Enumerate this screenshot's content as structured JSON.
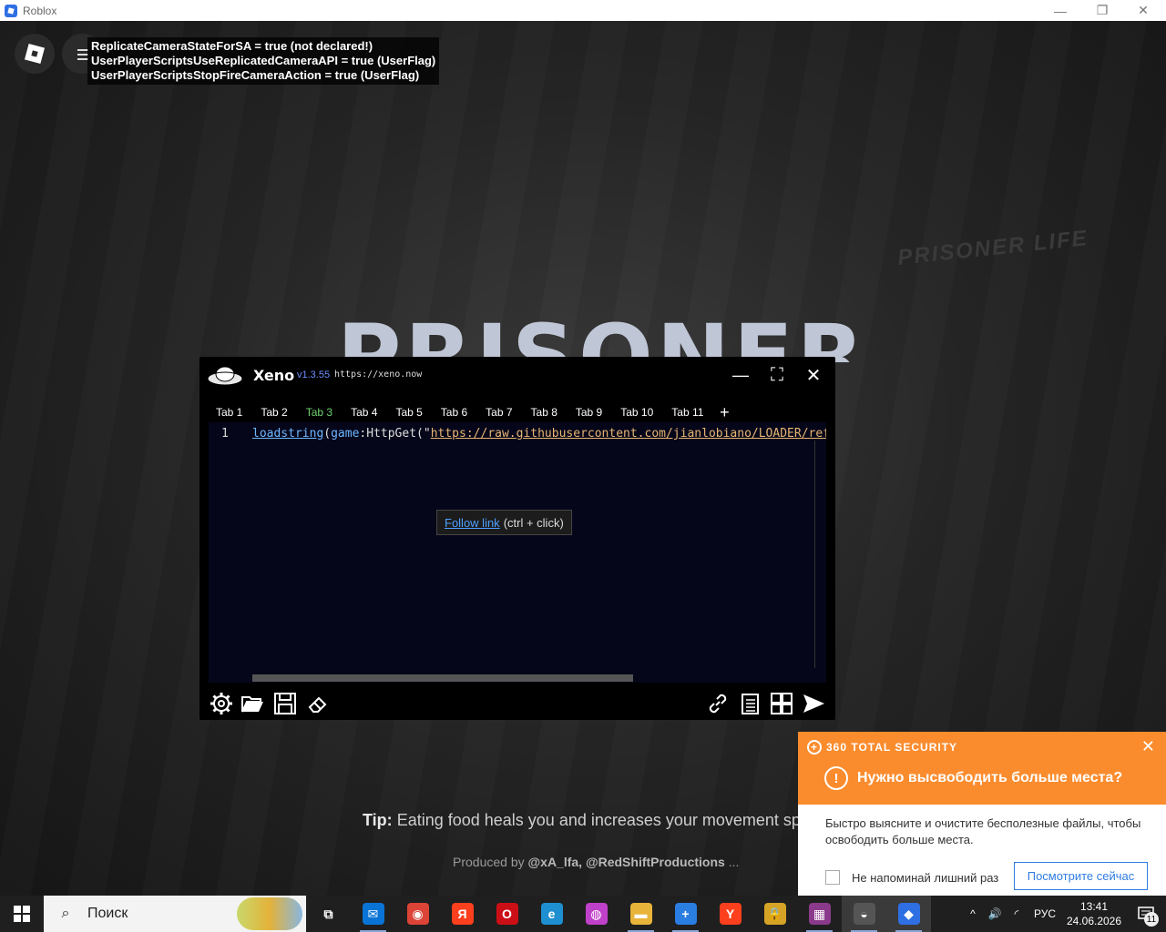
{
  "window": {
    "title": "Roblox",
    "minimize_glyph": "—",
    "restore_glyph": "❐",
    "close_glyph": "✕"
  },
  "game": {
    "debug_lines": [
      "ReplicateCameraStateForSA = true (not declared!)",
      "UserPlayerScriptsUseReplicatedCameraAPI = true (UserFlag)",
      "UserPlayerScriptsStopFireCameraAction = true (UserFlag)"
    ],
    "logo_small": "PRISONER LIFE",
    "logo_big": "PRISONER",
    "tip_label": "Tip:",
    "tip_text": "Eating food heals you and increases your movement speed",
    "produced_prefix": "Produced by",
    "produced_by": "@xA_lfa, @RedShiftProductions",
    "produced_suffix": "..."
  },
  "xeno": {
    "name": "Xeno",
    "version": "v1.3.55",
    "url": "https://xeno.now",
    "minimize_glyph": "—",
    "maximize_glyph": "⛶",
    "close_glyph": "✕",
    "tabs": [
      {
        "label": "Tab 1",
        "active": false
      },
      {
        "label": "Tab 2",
        "active": false
      },
      {
        "label": "Tab 3",
        "active": true
      },
      {
        "label": "Tab 4",
        "active": false
      },
      {
        "label": "Tab 5",
        "active": false
      },
      {
        "label": "Tab 6",
        "active": false
      },
      {
        "label": "Tab 7",
        "active": false
      },
      {
        "label": "Tab 8",
        "active": false
      },
      {
        "label": "Tab 9",
        "active": false
      },
      {
        "label": "Tab 10",
        "active": false
      },
      {
        "label": "Tab 11",
        "active": false
      }
    ],
    "add_tab_glyph": "+",
    "editor": {
      "line_number": "1",
      "code_fn": "loadstring",
      "code_open": "(",
      "code_game": "game",
      "code_method": ":HttpGet(\"",
      "code_string": "https://raw.githubusercontent.com/jianlobiano/LOADER/refs",
      "tooltip_link": "Follow link",
      "tooltip_hint": "(ctrl + click)"
    },
    "toolbar_icons": [
      "gear-icon",
      "folder-open-icon",
      "save-icon",
      "eraser-icon",
      "link-icon",
      "script-list-icon",
      "inject-icon",
      "execute-icon"
    ]
  },
  "popup": {
    "brand": "360 TOTAL SECURITY",
    "close_glyph": "✕",
    "alert_icon": "!",
    "headline": "Нужно высвободить больше места?",
    "body": "Быстро выясните и очистите бесполезные файлы, чтобы освободить больше места.",
    "checkbox_label": "Не напоминай лишний раз",
    "checkbox_checked": false,
    "action_button": "Посмотрите сейчас",
    "accent_color": "#fb8c2e"
  },
  "taskbar": {
    "search_placeholder": "Поиск",
    "apps": [
      {
        "name": "task-view",
        "glyph": "⧉",
        "color": "#1f1f1f"
      },
      {
        "name": "mail",
        "glyph": "✉",
        "color": "#0a74d6"
      },
      {
        "name": "chrome",
        "glyph": "◉",
        "color": "#db4437"
      },
      {
        "name": "yandex",
        "glyph": "Я",
        "color": "#fc3f1d"
      },
      {
        "name": "opera",
        "glyph": "O",
        "color": "#cc0f16"
      },
      {
        "name": "edge",
        "glyph": "e",
        "color": "#1e8fd0"
      },
      {
        "name": "color-app",
        "glyph": "◍",
        "color": "#c041c9"
      },
      {
        "name": "file-explorer",
        "glyph": "▬",
        "color": "#e8b43a"
      },
      {
        "name": "360-security",
        "glyph": "+",
        "color": "#2a7de1"
      },
      {
        "name": "yandex-browser",
        "glyph": "Y",
        "color": "#fc3f1d"
      },
      {
        "name": "lock-app",
        "glyph": "🔒",
        "color": "#d5a325"
      },
      {
        "name": "winrar",
        "glyph": "▦",
        "color": "#8b3a8b"
      },
      {
        "name": "xeno",
        "glyph": "◒",
        "color": "#555555"
      },
      {
        "name": "roblox",
        "glyph": "◆",
        "color": "#2f6fe4"
      }
    ],
    "active_apps": [
      "xeno",
      "roblox"
    ],
    "tray": {
      "chevron": "^",
      "volume": "🔊",
      "network": "◜",
      "language": "РУС",
      "time": "13:41",
      "date": "24.06.2026",
      "notification_count": "11"
    }
  }
}
